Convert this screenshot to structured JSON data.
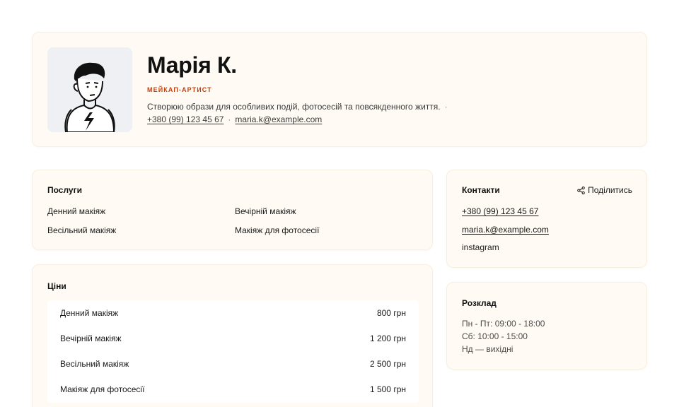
{
  "hero": {
    "avatar_icon": "person-illustration",
    "name": "Марія К.",
    "role": "МЕЙКАП-АРТИСТ",
    "bio": "Створюю образи для особливих подій, фотосесій та повсякденного життя.",
    "bio_separator": "·",
    "phone": "+380 (99) 123 45 67",
    "separator": "·",
    "email": "maria.k@example.com"
  },
  "services": {
    "title": "Послуги",
    "items": [
      "Денний макіяж",
      "Вечірній макіяж",
      "Весільний макіяж",
      "Макіяж для фотосесії"
    ]
  },
  "prices": {
    "title": "Ціни",
    "rows": [
      {
        "name": "Денний макіяж",
        "price": "800 грн"
      },
      {
        "name": "Вечірній макіяж",
        "price": "1 200 грн"
      },
      {
        "name": "Весільний макіяж",
        "price": "2 500 грн"
      },
      {
        "name": "Макіяж для фотосесії",
        "price": "1 500 грн"
      }
    ]
  },
  "contacts": {
    "title": "Контакти",
    "share_label": "Поділитись",
    "share_icon": "share-icon",
    "phone": "+380 (99) 123 45 67",
    "email": "maria.k@example.com",
    "instagram": "instagram"
  },
  "schedule": {
    "title": "Розклад",
    "lines": [
      "Пн - Пт: 09:00 - 18:00",
      "Сб: 10:00 - 15:00",
      "Нд — вихідні"
    ]
  },
  "colors": {
    "accent": "#c2410c",
    "card_bg": "#fffaf3",
    "avatar_bg": "#eef0f4"
  }
}
